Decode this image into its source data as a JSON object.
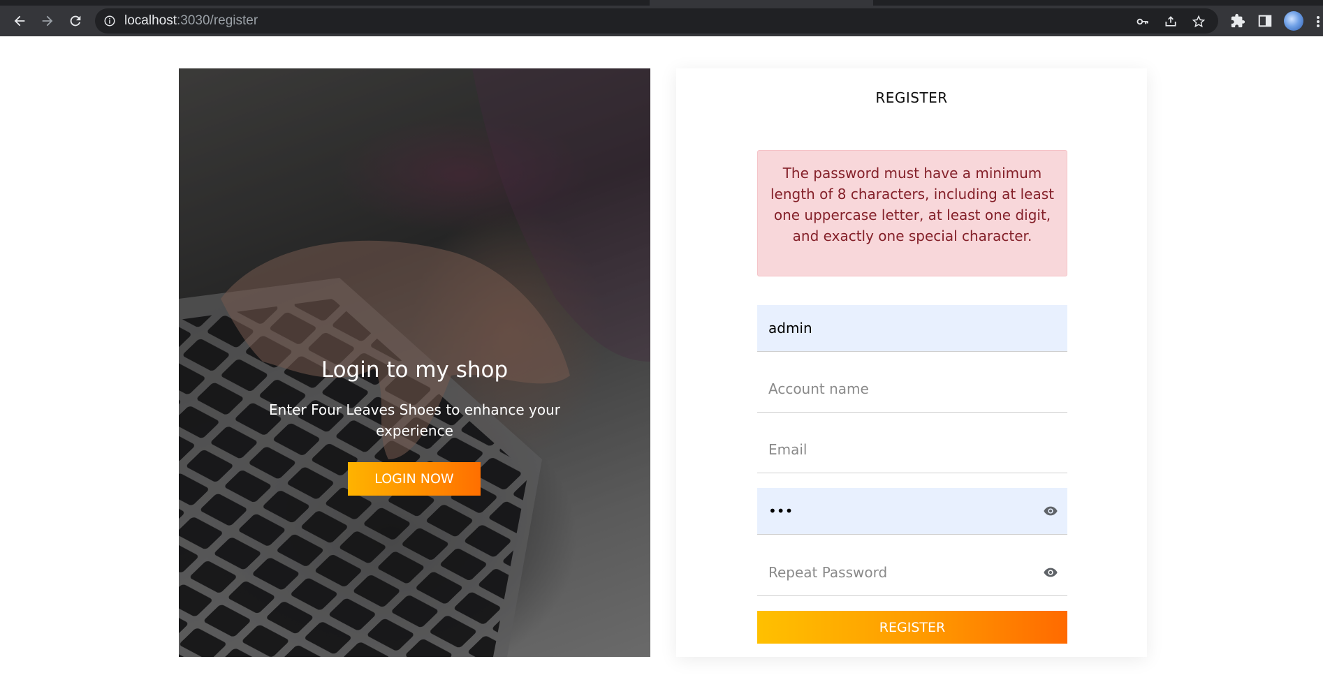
{
  "browser": {
    "url_host": "localhost",
    "url_path": ":3030/register",
    "icons": {
      "back": "arrow-left-icon",
      "forward": "arrow-right-icon",
      "reload": "reload-icon",
      "site_info": "info-circle-icon",
      "password_key": "key-icon",
      "share": "share-icon",
      "bookmark": "star-icon",
      "extensions": "puzzle-icon",
      "side_panel": "side-panel-icon",
      "profile": "avatar",
      "menu": "more-vert-icon"
    }
  },
  "hero": {
    "title": "Login to my shop",
    "subtitle": "Enter Four Leaves Shoes to enhance your experience",
    "button_label": "LOGIN NOW"
  },
  "register": {
    "title": "REGISTER",
    "alert": "The password must have a minimum length of 8 characters, including at least one uppercase letter, at least one digit, and exactly one special character.",
    "fields": {
      "username_value": "admin",
      "account_name_placeholder": "Account name",
      "email_placeholder": "Email",
      "password_value": "•••",
      "repeat_password_placeholder": "Repeat Password"
    },
    "button_label": "REGISTER"
  },
  "colors": {
    "accent_start": "#ffb300",
    "accent_end": "#ff6f00",
    "alert_bg": "#f8d7da",
    "alert_text": "#842029",
    "autofill_bg": "#e8f0fe"
  }
}
